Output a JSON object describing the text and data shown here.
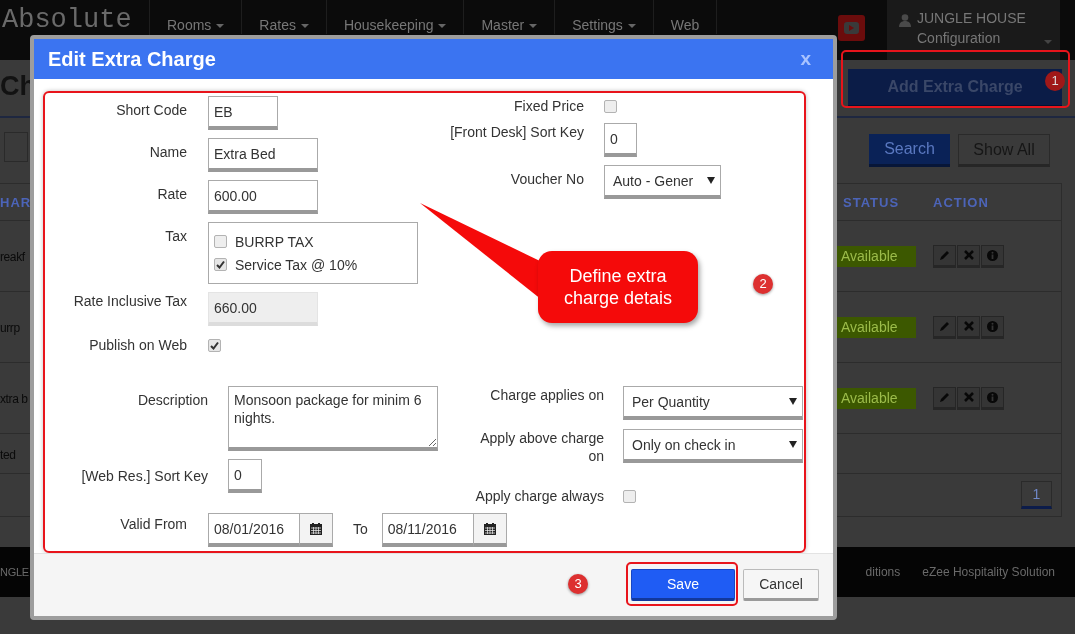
{
  "navbar": {
    "logo": "Absolute",
    "menu": [
      {
        "label": "Rooms",
        "dropdown": true
      },
      {
        "label": "Rates",
        "dropdown": true
      },
      {
        "label": "Housekeeping",
        "dropdown": true
      },
      {
        "label": "Master",
        "dropdown": true
      },
      {
        "label": "Settings",
        "dropdown": true
      },
      {
        "label": "Web",
        "dropdown": false
      }
    ],
    "user": {
      "name": "JUNGLE HOUSE",
      "role": "Configuration"
    }
  },
  "page": {
    "title": "Ch",
    "add_button": "Add Extra Charge",
    "search_button": "Search",
    "show_all_button": "Show All",
    "table": {
      "columns": [
        "HAR",
        "STATUS",
        "ACTION"
      ],
      "rows": [
        {
          "name": "reakf",
          "status": "Available"
        },
        {
          "name": "urrp",
          "status": "Available"
        },
        {
          "name": "xtra b",
          "status": "Available"
        },
        {
          "name": "ted"
        }
      ]
    },
    "pagination": [
      {
        "label": "1",
        "selected": true
      }
    ]
  },
  "footer": {
    "left": "NGLE",
    "middle": "ditions",
    "right": "eZee Hospitality Solution"
  },
  "dialog": {
    "title": "Edit Extra Charge",
    "close": "x",
    "upper_left": [
      {
        "kind": "text",
        "label": "Short Code",
        "value": "EB"
      },
      {
        "kind": "text",
        "label": "Name",
        "value": "Extra Bed"
      },
      {
        "kind": "text",
        "label": "Rate",
        "value": "600.00"
      },
      {
        "kind": "checklist",
        "label": "Tax",
        "options": [
          {
            "label": "BURRP TAX",
            "checked": false
          },
          {
            "label": "Service Tax @ 10%",
            "checked": true
          }
        ]
      },
      {
        "kind": "readonly",
        "label": "Rate Inclusive Tax",
        "value": "660.00"
      },
      {
        "kind": "checkbox",
        "label": "Publish on Web",
        "checked": true
      }
    ],
    "upper_right": [
      {
        "kind": "checkbox",
        "label": "Fixed Price",
        "checked": false
      },
      {
        "kind": "text",
        "label": "[Front Desk] Sort Key",
        "value": "0"
      },
      {
        "kind": "select",
        "label": "Voucher No",
        "value": "Auto - Gener"
      }
    ],
    "lower_left": [
      {
        "kind": "textarea",
        "label": "Description",
        "value": "Monsoon package for minim 6 nights."
      },
      {
        "kind": "text",
        "label": "[Web Res.] Sort Key",
        "value": "0"
      }
    ],
    "lower_right": [
      {
        "kind": "select",
        "label": "Charge applies on",
        "value": "Per Quantity"
      },
      {
        "kind": "select",
        "label": "Apply above charge on",
        "value": "Only on check in"
      },
      {
        "kind": "checkbox",
        "label": "Apply charge always",
        "checked": false
      }
    ],
    "valid": {
      "label": "Valid From",
      "from": "08/01/2016",
      "to_label": "To",
      "to": "08/11/2016"
    },
    "buttons": [
      {
        "label": "Save",
        "kind": "primary"
      },
      {
        "label": "Cancel",
        "kind": "default"
      }
    ]
  },
  "annotations": {
    "callout": "Define extra charge detais",
    "badges": [
      "1",
      "2",
      "3"
    ]
  }
}
